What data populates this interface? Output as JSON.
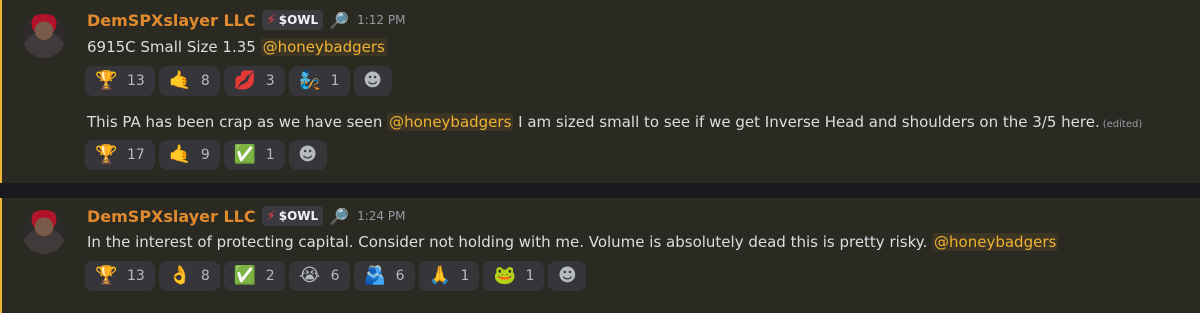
{
  "messages": [
    {
      "author": "DemSPXslayer LLC",
      "tag_icon": "⚡",
      "tag_label": "$OWL",
      "badge_icon": "magnifier-icon",
      "time": "1:12 PM",
      "lines": [
        {
          "prefix": "6915C Small Size 1.35 ",
          "mention": "@honeybadgers",
          "suffix": "",
          "edited": ""
        },
        {
          "prefix": "This PA has been crap as we have seen ",
          "mention": "@honeybadgers",
          "suffix": " I am sized small to see if we get Inverse Head and shoulders on the 3/5 here.",
          "edited": "(edited)"
        }
      ],
      "reactions_1": [
        {
          "emoji": "🏆",
          "count": "13",
          "name": "trophy"
        },
        {
          "emoji": "🤙",
          "count": "8",
          "name": "call-me-hand"
        },
        {
          "emoji": "💋",
          "count": "3",
          "name": "kiss-mark"
        },
        {
          "emoji": "🧞",
          "count": "1",
          "name": "custom-character"
        },
        {
          "emoji": "☻",
          "count": "",
          "name": "add-reaction"
        }
      ],
      "reactions_2": [
        {
          "emoji": "🏆",
          "count": "17",
          "name": "trophy"
        },
        {
          "emoji": "🤙",
          "count": "9",
          "name": "call-me-hand"
        },
        {
          "emoji": "✅",
          "count": "1",
          "name": "check-mark"
        },
        {
          "emoji": "☻",
          "count": "",
          "name": "add-reaction"
        }
      ]
    },
    {
      "author": "DemSPXslayer LLC",
      "tag_icon": "⚡",
      "tag_label": "$OWL",
      "badge_icon": "magnifier-icon",
      "time": "1:24 PM",
      "lines": [
        {
          "prefix": "In the interest of protecting capital. Consider not holding with me. Volume is absolutely dead this is pretty risky. ",
          "mention": "@honeybadgers",
          "suffix": "",
          "edited": ""
        }
      ],
      "reactions_1": [
        {
          "emoji": "🏆",
          "count": "13",
          "name": "trophy"
        },
        {
          "emoji": "👌",
          "count": "8",
          "name": "ok-hand"
        },
        {
          "emoji": "✅",
          "count": "2",
          "name": "check-mark"
        },
        {
          "emoji": "😭",
          "count": "6",
          "name": "crying-face"
        },
        {
          "emoji": "🫂",
          "count": "6",
          "name": "hugging-people"
        },
        {
          "emoji": "🙏",
          "count": "1",
          "name": "folded-hands"
        },
        {
          "emoji": "🐸",
          "count": "1",
          "name": "pepe-frog"
        },
        {
          "emoji": "☻",
          "count": "",
          "name": "add-reaction"
        }
      ]
    }
  ],
  "colors": {
    "accent": "#f0b232",
    "username": "#e08a2e",
    "background": "#2a2a22"
  }
}
